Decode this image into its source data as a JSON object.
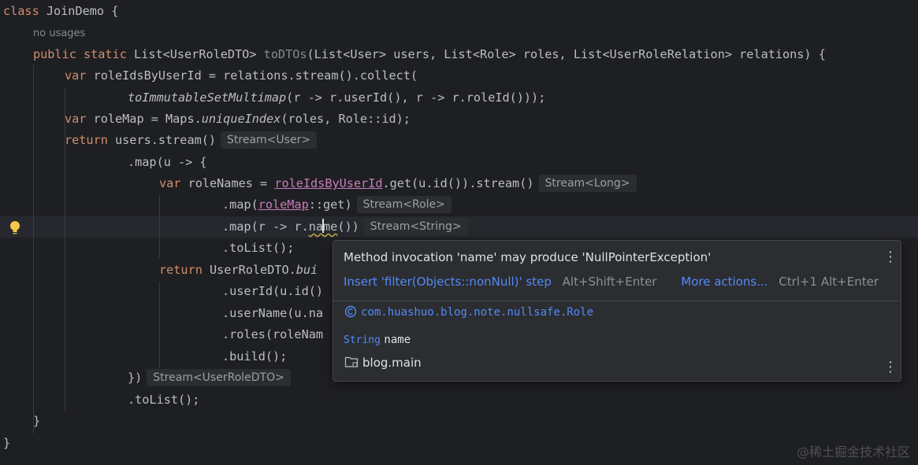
{
  "editor": {
    "class_decl": {
      "keyword": "class",
      "name": "JoinDemo",
      "brace": "{"
    },
    "usages": "no usages",
    "method": {
      "modifiers": "public static",
      "return_type": "List<UserRoleDTO>",
      "name": "toDTOs",
      "params": "(List<User> users, List<Role> roles, List<UserRoleRelation> relations) {"
    },
    "code": {
      "l1_kw": "var",
      "l1_rest": " roleIdsByUserId = relations.stream().collect(",
      "l2_fn": "toImmutableSetMultimap",
      "l2_rest": "(r -> r.userId(), r -> r.roleId()));",
      "l3_kw": "var",
      "l3_a": " roleMap = Maps.",
      "l3_fn": "uniqueIndex",
      "l3_b": "(roles, Role::id);",
      "l4_kw": "return",
      "l4_rest": " users.stream()",
      "l4_hint": "Stream<User>",
      "l5": ".map(u -> {",
      "l6_kw": "var",
      "l6_a": " roleNames = ",
      "l6_var": "roleIdsByUserId",
      "l6_b": ".get(u.id()).stream()",
      "l6_hint": "Stream<Long>",
      "l7_a": ".map(",
      "l7_var": "roleMap",
      "l7_b": "::get)",
      "l7_hint": "Stream<Role>",
      "l8_a": ".map(r -> r.",
      "l8_na": "na",
      "l8_me": "me",
      "l8_b": "())",
      "l8_hint": "Stream<String>",
      "l9": ".toList();",
      "l10_kw": "return",
      "l10_a": " UserRoleDTO.",
      "l10_fn": "bui",
      "l11": ".userId(u.id()",
      "l12": ".userName(u.na",
      "l13": ".roles(roleNam",
      "l14": ".build();",
      "l15": "})",
      "l15_hint": "Stream<UserRoleDTO>",
      "l16": ".toList();",
      "l17": "}",
      "l18": "}"
    }
  },
  "popup": {
    "message": "Method invocation 'name' may produce 'NullPointerException'",
    "quickfix": "Insert 'filter(Objects::nonNull)' step",
    "quickfix_shortcut": "Alt+Shift+Enter",
    "more_actions": "More actions...",
    "more_shortcut": "Ctrl+1 Alt+Enter",
    "class_fqn": "com.huashuo.blog.note.nullsafe.Role",
    "field_type": "String",
    "field_name": "name",
    "module": "blog.main"
  },
  "watermark": "@稀土掘金技术社区",
  "colors": {
    "background": "#1e1f22",
    "keyword": "#cf8e6d",
    "method": "#56a8f5",
    "local_var": "#c77dbb",
    "link": "#548af7",
    "warning": "#c2a93f"
  },
  "icons": [
    "lightbulb-icon",
    "class-c-icon",
    "folder-module-icon",
    "more-vertical-icon"
  ]
}
